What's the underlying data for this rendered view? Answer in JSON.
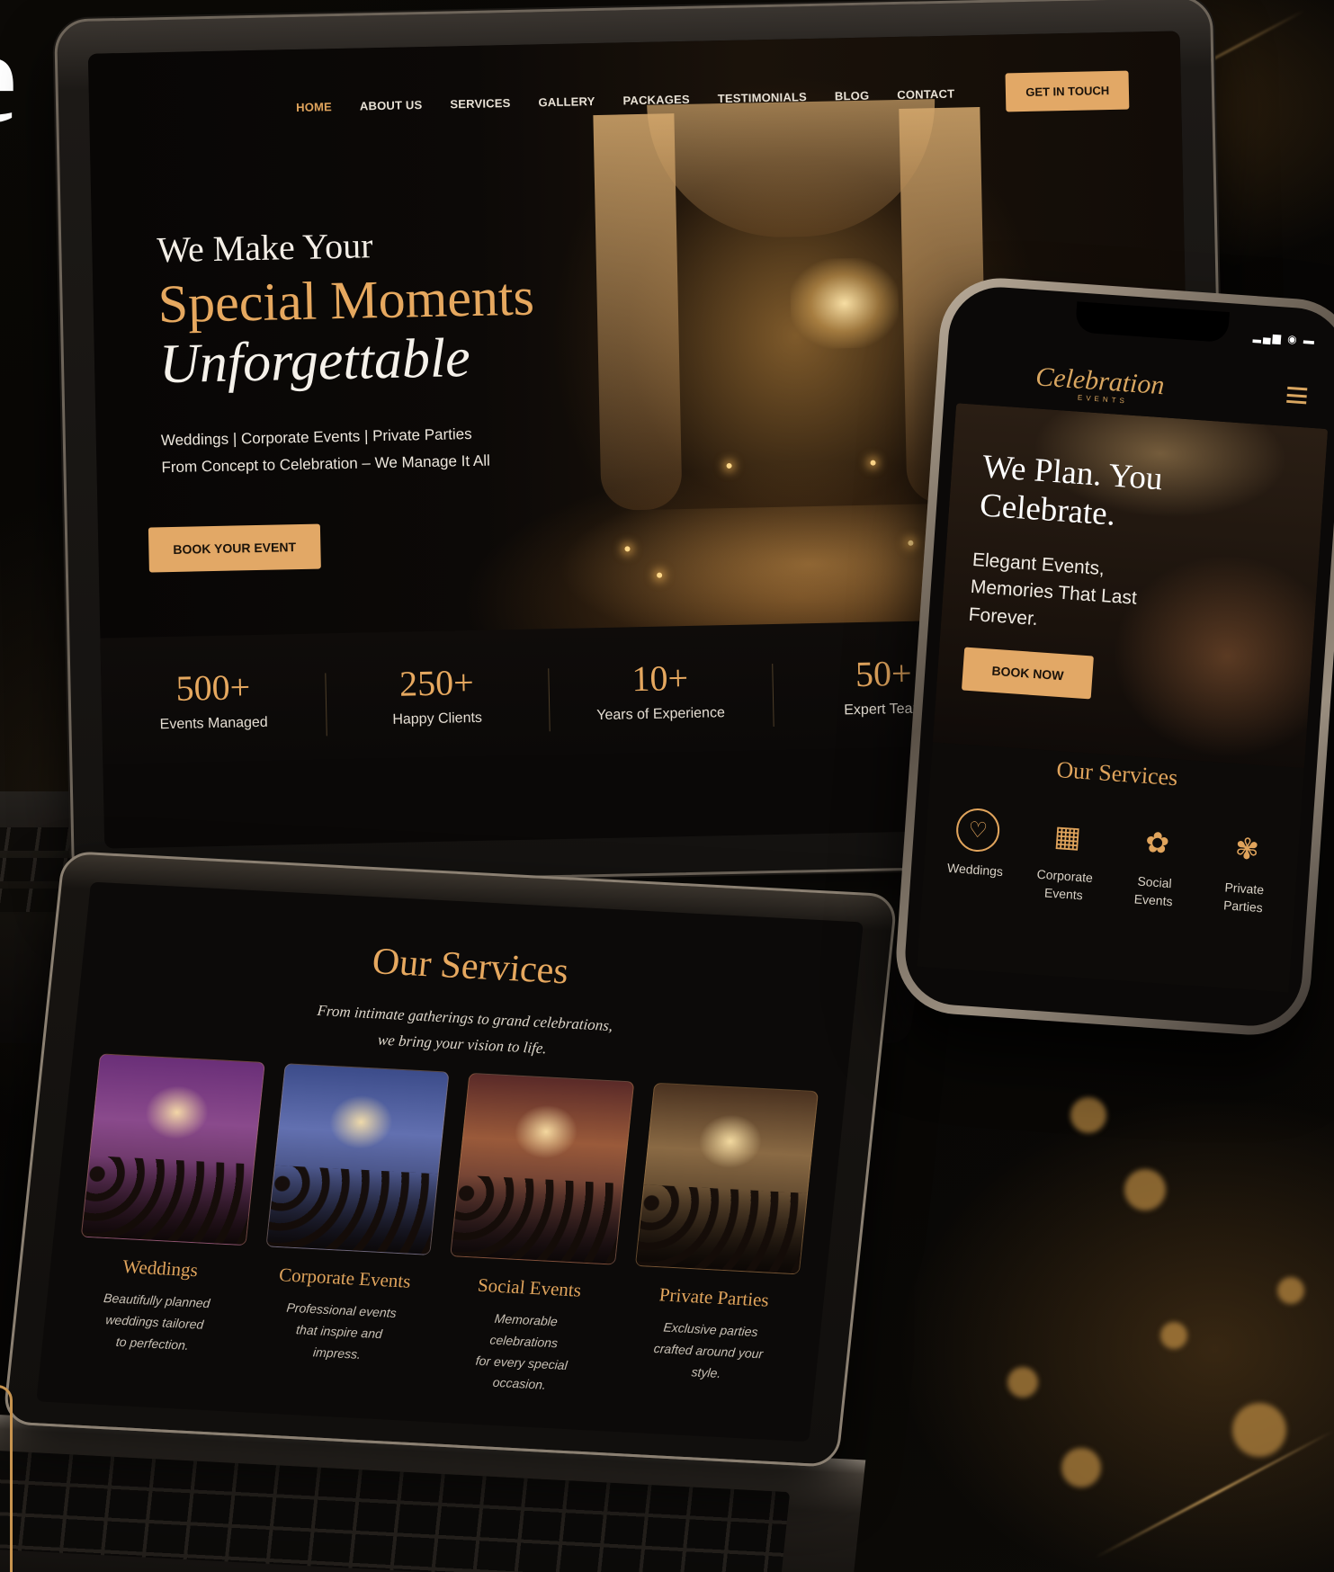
{
  "heading_fragment": "e",
  "desktop": {
    "nav": {
      "items": [
        "HOME",
        "ABOUT US",
        "SERVICES",
        "GALLERY",
        "PACKAGES",
        "TESTIMONIALS",
        "BLOG",
        "CONTACT"
      ],
      "active": "HOME",
      "cta": "GET IN TOUCH"
    },
    "hero": {
      "line1": "We Make Your",
      "line2": "Special Moments",
      "line3": "Unforgettable",
      "sub1": "Weddings | Corporate Events | Private Parties",
      "sub2": "From Concept to Celebration – We Manage It All",
      "button": "BOOK YOUR EVENT"
    },
    "stats": [
      {
        "value": "500+",
        "label": "Events Managed"
      },
      {
        "value": "250+",
        "label": "Happy Clients"
      },
      {
        "value": "10+",
        "label": "Years of Experience"
      },
      {
        "value": "50+",
        "label": "Expert Team"
      }
    ]
  },
  "mobile": {
    "logo": "Celebration",
    "logo_sub": "EVENTS",
    "hero_title_1": "We Plan. You",
    "hero_title_2": "Celebrate.",
    "hero_sub_1": "Elegant Events,",
    "hero_sub_2": "Memories That Last",
    "hero_sub_3": "Forever.",
    "button": "BOOK NOW",
    "services_title": "Our Services",
    "services": [
      {
        "label1": "Weddings",
        "label2": "",
        "icon": "heart-icon"
      },
      {
        "label1": "Corporate",
        "label2": "Events",
        "icon": "building-icon"
      },
      {
        "label1": "Social",
        "label2": "Events",
        "icon": "flower-icon"
      },
      {
        "label1": "Private",
        "label2": "Parties",
        "icon": "ribbon-icon"
      }
    ]
  },
  "services_page": {
    "title": "Our Services",
    "sub1": "From intimate gatherings to grand celebrations,",
    "sub2": "we bring your vision to life.",
    "cards": [
      {
        "name": "Weddings",
        "desc1": "Beautifully planned",
        "desc2": "weddings tailored",
        "desc3": "to perfection."
      },
      {
        "name": "Corporate Events",
        "desc1": "Professional events",
        "desc2": "that inspire and",
        "desc3": "impress."
      },
      {
        "name": "Social Events",
        "desc1": "Memorable celebrations",
        "desc2": "for every special",
        "desc3": "occasion."
      },
      {
        "name": "Private Parties",
        "desc1": "Exclusive parties",
        "desc2": "crafted around your",
        "desc3": "style."
      }
    ]
  },
  "colors": {
    "accent": "#e2a866",
    "gold_text": "#e6a85f",
    "background": "#0a0807"
  }
}
